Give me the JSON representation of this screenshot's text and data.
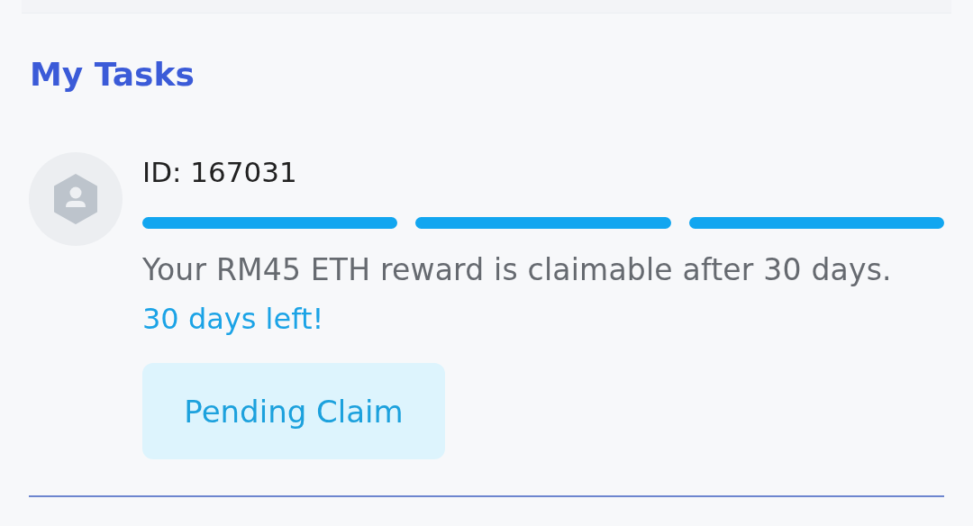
{
  "section_title": "My Tasks",
  "task": {
    "id_label": "ID: 167031",
    "progress_segments": [
      {
        "completed": true
      },
      {
        "completed": true
      },
      {
        "completed": true
      }
    ],
    "description": "Your RM45 ETH reward is claimable after 30 days.",
    "countdown": "30 days left!",
    "button": {
      "label": "Pending Claim",
      "disabled": true
    }
  }
}
